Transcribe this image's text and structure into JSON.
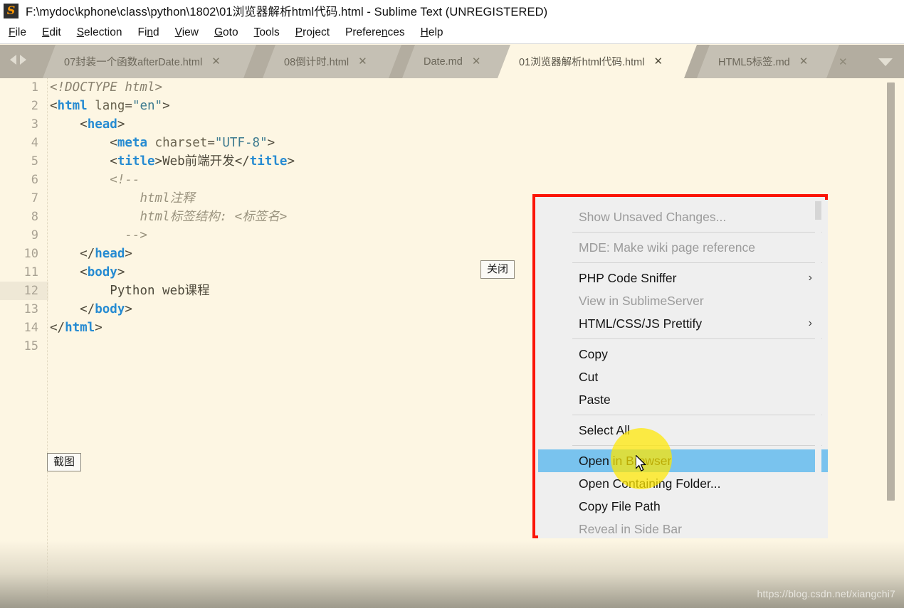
{
  "titlebar": {
    "icon": "sublime-text-logo-icon",
    "icon_glyph": "S",
    "title": "F:\\mydoc\\kphone\\class\\python\\1802\\01浏览器解析html代码.html - Sublime Text (UNREGISTERED)"
  },
  "menubar": {
    "items": [
      {
        "label": "File",
        "accel": "F"
      },
      {
        "label": "Edit",
        "accel": "E"
      },
      {
        "label": "Selection",
        "accel": "S"
      },
      {
        "label": "Find",
        "accel": "n"
      },
      {
        "label": "View",
        "accel": "V"
      },
      {
        "label": "Goto",
        "accel": "G"
      },
      {
        "label": "Tools",
        "accel": "T"
      },
      {
        "label": "Project",
        "accel": "P"
      },
      {
        "label": "Preferences",
        "accel": "n"
      },
      {
        "label": "Help",
        "accel": "H"
      }
    ]
  },
  "tabbar": {
    "nav_prev_icon": "arrow-left-icon",
    "nav_next_icon": "arrow-right-icon",
    "close_glyph": "✕",
    "dropdown_icon": "chevron-down-icon",
    "tabs": [
      {
        "label": "07封装一个函数afterDate.html",
        "active": false
      },
      {
        "label": "08倒计时.html",
        "active": false
      },
      {
        "label": "Date.md",
        "active": false
      },
      {
        "label": "01浏览器解析html代码.html",
        "active": true
      },
      {
        "label": "HTML5标签.md",
        "active": false
      }
    ]
  },
  "editor": {
    "line_numbers": [
      "1",
      "2",
      "3",
      "4",
      "5",
      "6",
      "7",
      "8",
      "9",
      "10",
      "11",
      "12",
      "13",
      "14",
      "15"
    ],
    "highlighted_line": 12,
    "lines": [
      "<!DOCTYPE html>",
      "<html lang=\"en\">",
      "    <head>",
      "        <meta charset=\"UTF-8\">",
      "        <title>Web前端开发</title>",
      "        <!--",
      "            html注释",
      "            html标签结构: <标签名>",
      "          -->",
      "    </head>",
      "    <body>",
      "        Python web课程",
      "    </body>",
      "</html>",
      ""
    ]
  },
  "context_menu": {
    "border_color": "#fb1406",
    "highlight_color": "#79c3ee",
    "submenu_arrow": "›",
    "items": [
      {
        "label": "Show Unsaved Changes...",
        "disabled": true,
        "submenu": false,
        "selected": false
      },
      {
        "separator": true
      },
      {
        "label": "MDE: Make wiki page reference",
        "disabled": true,
        "submenu": false,
        "selected": false
      },
      {
        "separator": true
      },
      {
        "label": "PHP Code Sniffer",
        "disabled": false,
        "submenu": true,
        "selected": false
      },
      {
        "label": "View in SublimeServer",
        "disabled": true,
        "submenu": false,
        "selected": false
      },
      {
        "label": "HTML/CSS/JS Prettify",
        "disabled": false,
        "submenu": true,
        "selected": false
      },
      {
        "separator": true
      },
      {
        "label": "Copy",
        "disabled": false,
        "submenu": false,
        "selected": false
      },
      {
        "label": "Cut",
        "disabled": false,
        "submenu": false,
        "selected": false
      },
      {
        "label": "Paste",
        "disabled": false,
        "submenu": false,
        "selected": false
      },
      {
        "separator": true
      },
      {
        "label": "Select All",
        "disabled": false,
        "submenu": false,
        "selected": false
      },
      {
        "separator": true
      },
      {
        "label": "Open in Browser",
        "disabled": false,
        "submenu": false,
        "selected": true
      },
      {
        "label": "Open Containing Folder...",
        "disabled": false,
        "submenu": false,
        "selected": false
      },
      {
        "label": "Copy File Path",
        "disabled": false,
        "submenu": false,
        "selected": false
      },
      {
        "label": "Reveal in Side Bar",
        "disabled": true,
        "submenu": false,
        "selected": false
      }
    ]
  },
  "annotations": {
    "close_label": "关闭",
    "screenshot_label": "截图"
  },
  "watermark": {
    "text": "https://blog.csdn.net/xiangchi7"
  }
}
